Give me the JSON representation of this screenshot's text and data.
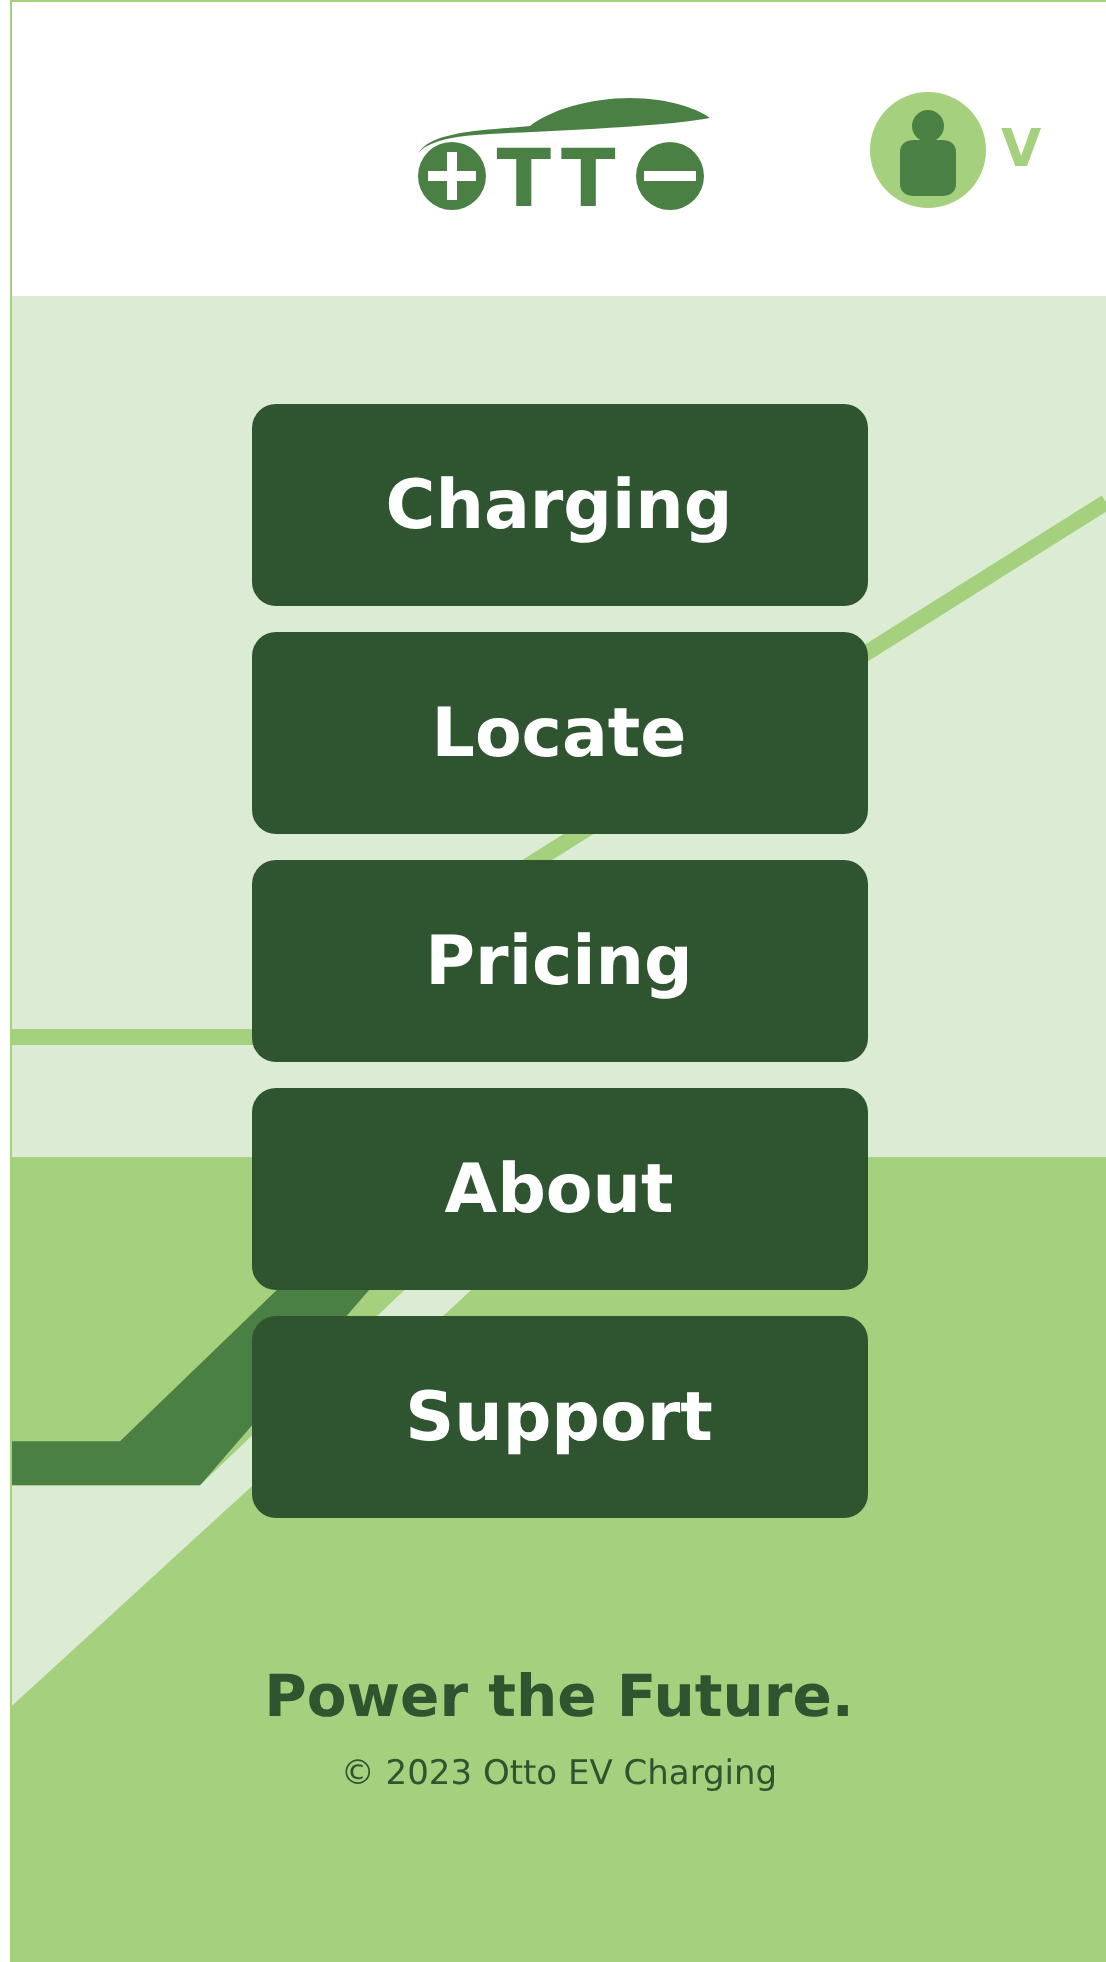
{
  "header": {
    "logo": {
      "letters": "TT"
    },
    "user": {
      "initial": "V"
    }
  },
  "nav": [
    {
      "label": "Charging"
    },
    {
      "label": "Locate"
    },
    {
      "label": "Pricing"
    },
    {
      "label": "About"
    },
    {
      "label": "Support"
    }
  ],
  "footer": {
    "tagline": "Power the Future.",
    "copyright": "© 2023 Otto EV Charging"
  }
}
